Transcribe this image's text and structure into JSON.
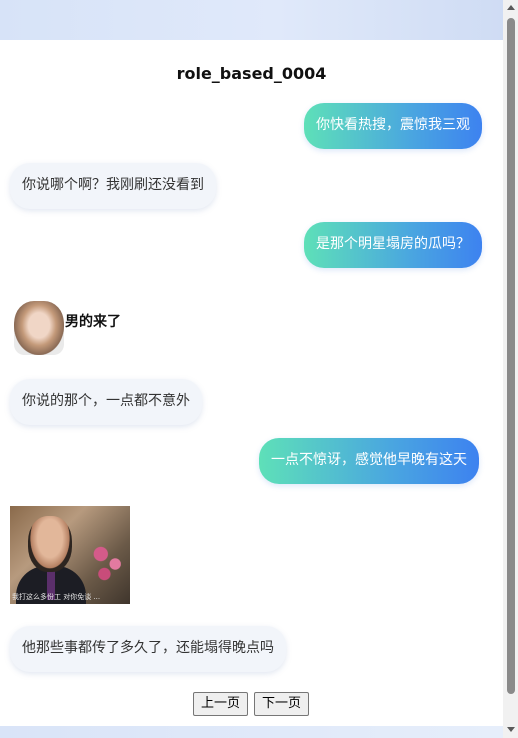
{
  "title": "role_based_0004",
  "messages": [
    {
      "side": "right",
      "text": "你快看热搜，震惊我三观"
    },
    {
      "side": "left",
      "text": "你说哪个啊？我刚刷还没看到"
    },
    {
      "side": "right",
      "text": "是那个明星塌房的瓜吗？"
    },
    {
      "side": "left",
      "type": "sticker",
      "text": "男的来了"
    },
    {
      "side": "left",
      "text": "你说的那个，一点都不意外"
    },
    {
      "side": "right",
      "text": "一点不惊讶，感觉他早晚有这天"
    },
    {
      "side": "left",
      "type": "sticker",
      "subtitle": "我打这么多份工 对你免谈 ..."
    },
    {
      "side": "left",
      "text": "他那些事都传了多久了，还能塌得晚点吗"
    }
  ],
  "pagination": {
    "prev_label": "上一页",
    "next_label": "下一页"
  }
}
